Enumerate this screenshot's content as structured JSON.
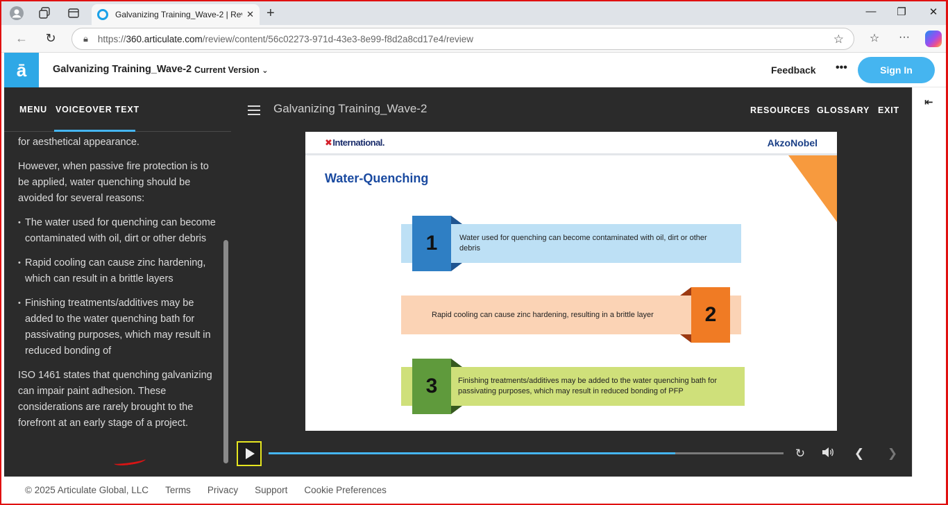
{
  "browser": {
    "tab_title": "Galvanizing Training_Wave-2 | Rev",
    "url_prefix": "https://",
    "url_host": "360.articulate.com",
    "url_path": "/review/content/56c02273-971d-43e3-8e99-f8d2a8cd17e4/review"
  },
  "header": {
    "logo_glyph": "ā",
    "course_title": "Galvanizing Training_Wave-2",
    "version_label": "Current Version",
    "feedback_label": "Feedback",
    "more_label": "•••",
    "signin_label": "Sign In"
  },
  "sidebar": {
    "tab_menu": "MENU",
    "tab_voiceover": "VOICEOVER TEXT",
    "paragraph_1": "for aesthetical appearance.",
    "paragraph_2": "However, when passive fire protection is to be applied, water quenching should be avoided for several reasons:",
    "bullets": [
      "The water used for quenching can become contaminated with oil, dirt or other debris",
      "Rapid cooling can cause zinc hardening, which can result in a brittle layers",
      "Finishing treatments/additives may be added to the water quenching bath for passivating purposes, which may result in reduced bonding of"
    ],
    "paragraph_3": "ISO 1461 states that quenching galvanizing can impair paint adhesion. These considerations are rarely brought to the forefront at an early stage of a project."
  },
  "player": {
    "title": "Galvanizing Training_Wave-2",
    "nav_resources": "RESOURCES",
    "nav_glossary": "GLOSSARY",
    "nav_exit": "EXIT",
    "progress_fraction": 0.79
  },
  "slide": {
    "brand_left_x": "✖",
    "brand_left": "International.",
    "brand_right": "AkzoNobel",
    "heading": "Water-Quenching",
    "items": [
      {
        "number": "1",
        "text": "Water used for quenching can become contaminated with oil, dirt or other debris"
      },
      {
        "number": "2",
        "text": "Rapid cooling can cause zinc hardening, resulting in a brittle layer"
      },
      {
        "number": "3",
        "text": "Finishing treatments/additives may be added to the water quenching bath for passivating purposes, which may result in reduced bonding of PFP"
      }
    ]
  },
  "footer": {
    "copyright": "© 2025 Articulate Global, LLC",
    "terms": "Terms",
    "privacy": "Privacy",
    "support": "Support",
    "cookies": "Cookie Preferences"
  },
  "colors": {
    "accent": "#45b5f0",
    "band_blue": "#bde0f5",
    "num_blue": "#2f7fc4",
    "band_peach": "#fbd3b5",
    "num_orange": "#f07b24",
    "band_green": "#cfe07a",
    "num_green": "#5f9a3c",
    "slide_triangle": "#f79a3e"
  }
}
